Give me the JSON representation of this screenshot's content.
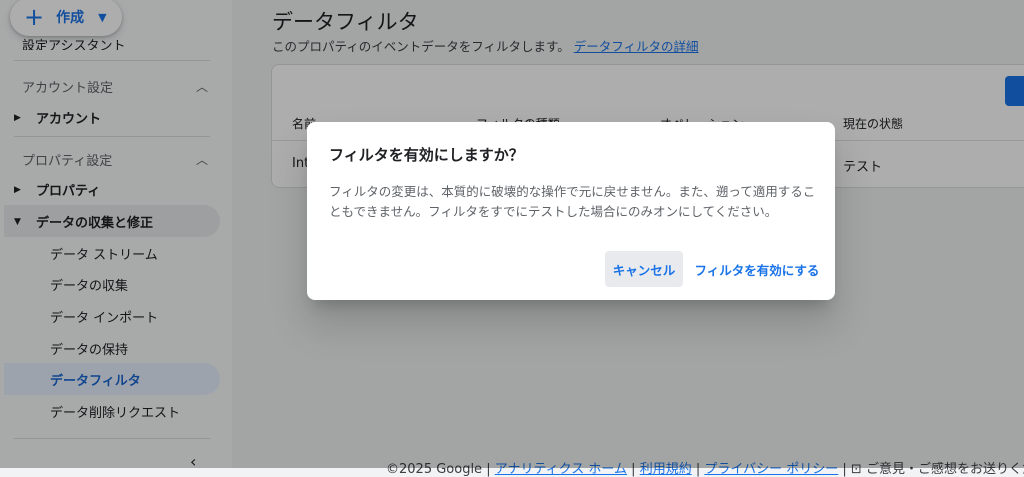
{
  "create_button": {
    "label": "作成"
  },
  "sidebar": {
    "partial_item": "設定アシスタント",
    "account_section": {
      "header": "アカウント設定",
      "items": [
        {
          "label": "アカウント"
        }
      ]
    },
    "property_section": {
      "header": "プロパティ設定",
      "items": [
        {
          "label": "プロパティ"
        },
        {
          "label": "データの収集と修正"
        }
      ],
      "sub_items": [
        {
          "label": "データ ストリーム"
        },
        {
          "label": "データの収集"
        },
        {
          "label": "データ インポート"
        },
        {
          "label": "データの保持"
        },
        {
          "label": "データフィルタ"
        },
        {
          "label": "データ削除リクエスト"
        }
      ]
    }
  },
  "main": {
    "title": "データフィルタ",
    "description": "このプロパティのイベントデータをフィルタします。",
    "description_link": "データフィルタの詳細",
    "table": {
      "headers": [
        "名前",
        "フィルタの種類",
        "オペレーション",
        "現在の状態"
      ],
      "row": {
        "name": "Int",
        "status": "テスト"
      }
    },
    "footer": {
      "copyright": "©2025 Google",
      "links": [
        "アナリティクス ホーム",
        "利用規約",
        "プライバシー ポリシー"
      ],
      "feedback": "ご意見・ご感想をお送りください"
    }
  },
  "dialog": {
    "title": "フィルタを有効にしますか？",
    "body": "フィルタの変更は、本質的に破壊的な操作で元に戻せません。また、遡って適用することもできません。フィルタをすでにテストした場合にのみオンにしてください。",
    "cancel_label": "キャンセル",
    "confirm_label": "フィルタを有効にする"
  },
  "colors": {
    "accent": "#1a73e8",
    "overlay": "rgba(0,0,0,0.32)"
  }
}
